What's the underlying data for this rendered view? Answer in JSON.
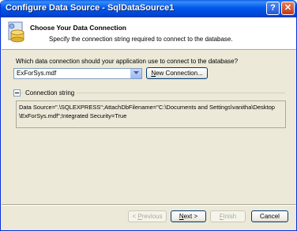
{
  "window": {
    "title": "Configure Data Source - SqlDataSource1"
  },
  "header": {
    "title": "Choose Your Data Connection",
    "subtitle": "Specify the connection string required to connect to the database."
  },
  "main": {
    "question": "Which data connection should your application use to connect to the database?",
    "connection_select": {
      "value": "ExForSys.mdf"
    },
    "new_connection_button": {
      "mnemonic": "N",
      "rest": "ew Connection..."
    },
    "connection_string_label": "Connection string",
    "connection_string_lines": [
      "Data Source=\".\\SQLEXPRESS\";AttachDbFilename=\"C:\\Documents and Settings\\vanitha\\Desktop",
      "\\ExForSys.mdf\";Integrated Security=True"
    ]
  },
  "footer": {
    "previous": {
      "pre": "< ",
      "mnemonic": "P",
      "rest": "revious"
    },
    "next": {
      "mnemonic": "N",
      "rest": "ext >"
    },
    "finish": {
      "mnemonic": "F",
      "rest": "inish"
    },
    "cancel": "Cancel"
  },
  "colors": {
    "titlebar": "#0058ee",
    "window_bg": "#ece9d8",
    "close_button": "#c3381a"
  }
}
